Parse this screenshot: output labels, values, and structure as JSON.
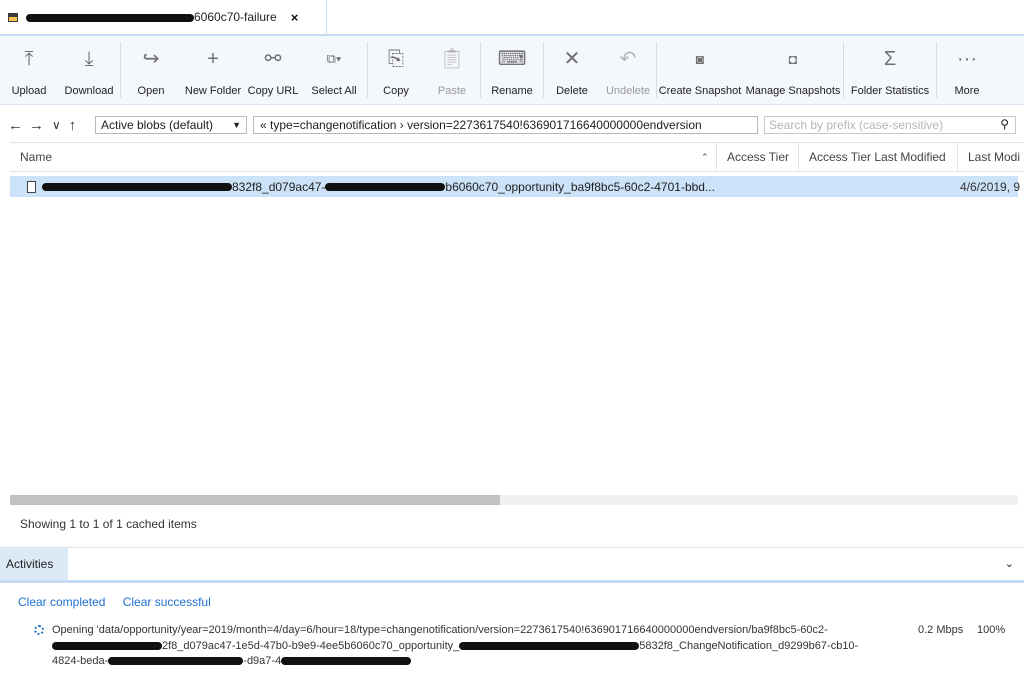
{
  "tab": {
    "title_visible": "6060c70-failure",
    "close": "×"
  },
  "toolbar": {
    "upload": "Upload",
    "download": "Download",
    "open": "Open",
    "new_folder": "New Folder",
    "copy_url": "Copy URL",
    "select_all": "Select All",
    "copy": "Copy",
    "paste": "Paste",
    "rename": "Rename",
    "delete": "Delete",
    "undelete": "Undelete",
    "create_snapshot": "Create Snapshot",
    "manage_snapshots": "Manage Snapshots",
    "folder_statistics": "Folder Statistics",
    "more": "More"
  },
  "address": {
    "view_select": "Active blobs (default)",
    "path": "«  type=changenotification  ›  version=2273617540!636901716640000000endversion",
    "search_placeholder": "Search by prefix (case-sensitive)"
  },
  "columns": {
    "name": "Name",
    "access_tier": "Access Tier",
    "access_tier_modified": "Access Tier Last Modified",
    "last_modified": "Last Modi"
  },
  "rows": [
    {
      "name_visible": "832f8_d079ac47-",
      "name_visible_2": "b6060c70_opportunity_ba9f8bc5-60c2-4701-bbd...",
      "modified": "4/6/2019, 9"
    }
  ],
  "status": "Showing 1 to 1 of 1 cached items",
  "activities": {
    "tab": "Activities",
    "clear_completed": "Clear completed",
    "clear_successful": "Clear successful",
    "job_line1": "Opening 'data/opportunity/year=2019/month=4/day=6/hour=18/type=changenotification/version=2273617540!636901716640000000endversion/ba9f8bc5-60c2-",
    "job_line2a": "2f8_d079ac47-1e5d-47b0-b9e9-4ee5b6060c70_opportunity_",
    "job_line2b": "5832f8_ChangeNotification_d9299b67-cb10-",
    "job_line3a": "4824-beda-",
    "job_line3b": "-d9a7-4",
    "speed": "0.2 Mbps",
    "percent": "100%"
  }
}
